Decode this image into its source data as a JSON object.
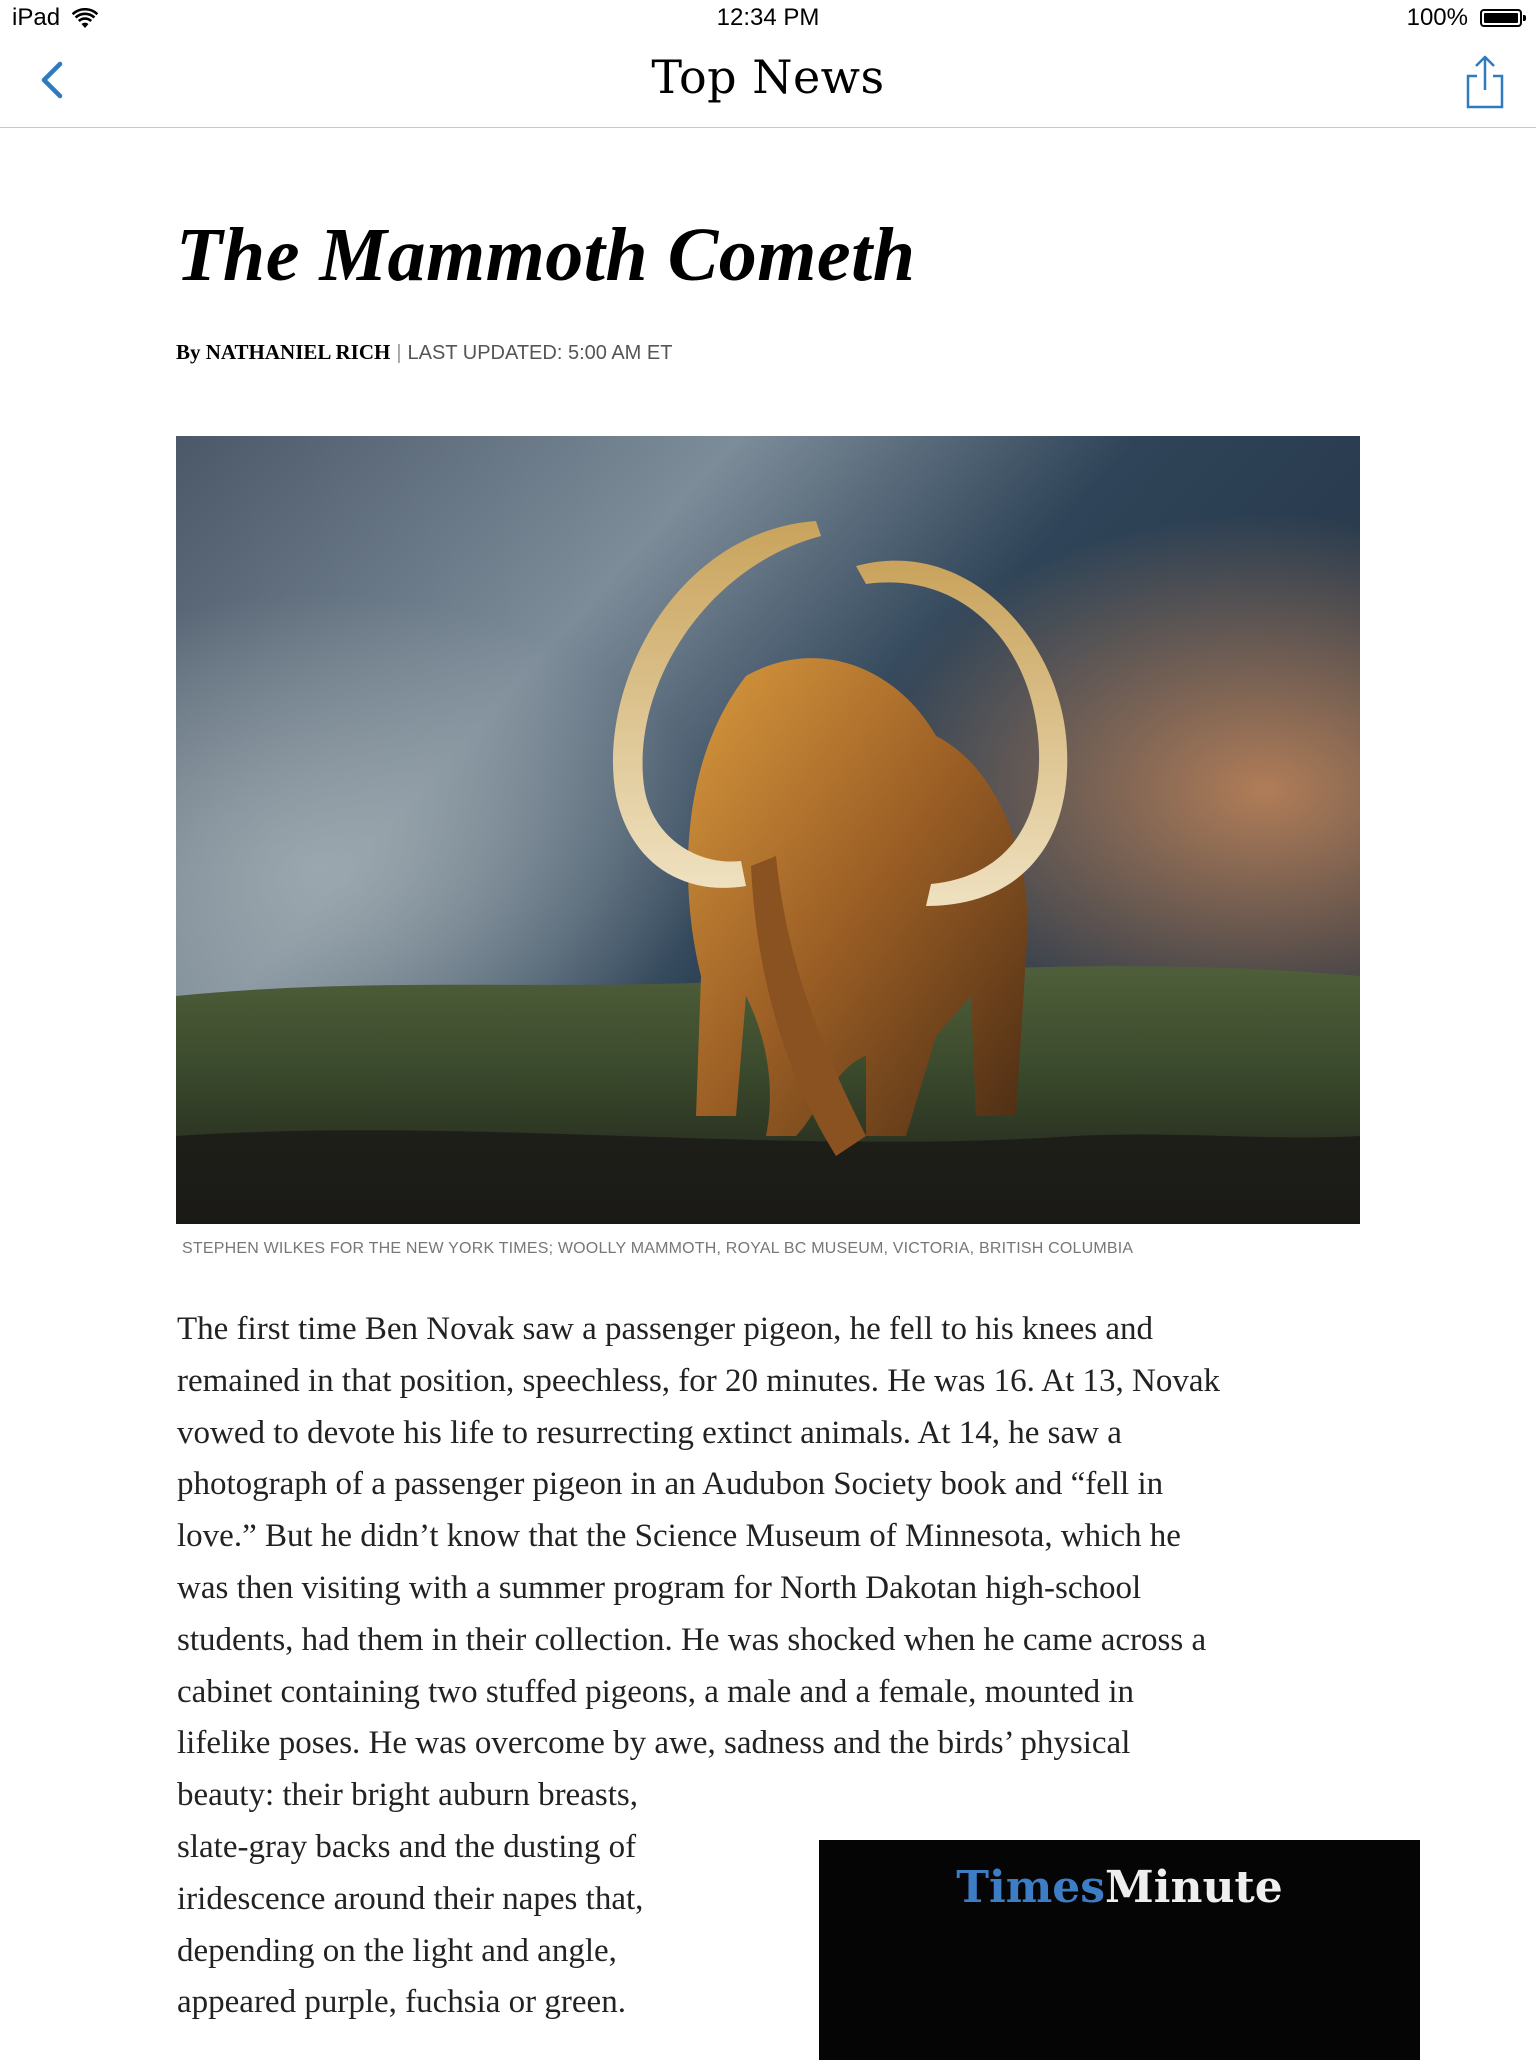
{
  "status_bar": {
    "carrier": "iPad",
    "time": "12:34 PM",
    "battery": "100%"
  },
  "nav": {
    "title": "Top News",
    "back_icon": "chevron-left-icon",
    "share_icon": "share-icon",
    "accent": "#2f7bbf"
  },
  "article": {
    "headline": "The Mammoth Cometh",
    "byline_author": "By NATHANIEL RICH",
    "byline_separator": "|",
    "byline_updated": "LAST UPDATED: 5:00 AM ET",
    "photo_credit": "STEPHEN WILKES FOR THE NEW YORK TIMES; WOOLLY MAMMOTH, ROYAL BC MUSEUM, VICTORIA, BRITISH COLUMBIA",
    "body_lines": [
      "The first time Ben Novak saw a passenger pigeon, he fell to his knees and",
      "remained in that position, speechless, for 20 minutes. He was 16. At 13, Novak",
      "vowed to devote his life to resurrecting extinct animals. At 14, he saw a",
      "photograph of a passenger pigeon in an Audubon Society book and “fell in",
      "love.” But he didn’t know that the Science Museum of Minnesota, which he",
      "was then visiting with a summer program for North Dakotan high-school",
      "students, had them in their collection. He was shocked when he came across a",
      "cabinet containing two stuffed pigeons, a male and a female, mounted in",
      "lifelike poses. He was overcome by awe, sadness and the birds’ physical",
      "beauty: their bright auburn breasts,",
      "slate-gray backs and the dusting of",
      "iridescence around their napes that,",
      "depending on the light and angle,",
      "appeared purple, fuchsia or green."
    ]
  },
  "video": {
    "logo_part1": "Times",
    "logo_part2": "Minute"
  }
}
